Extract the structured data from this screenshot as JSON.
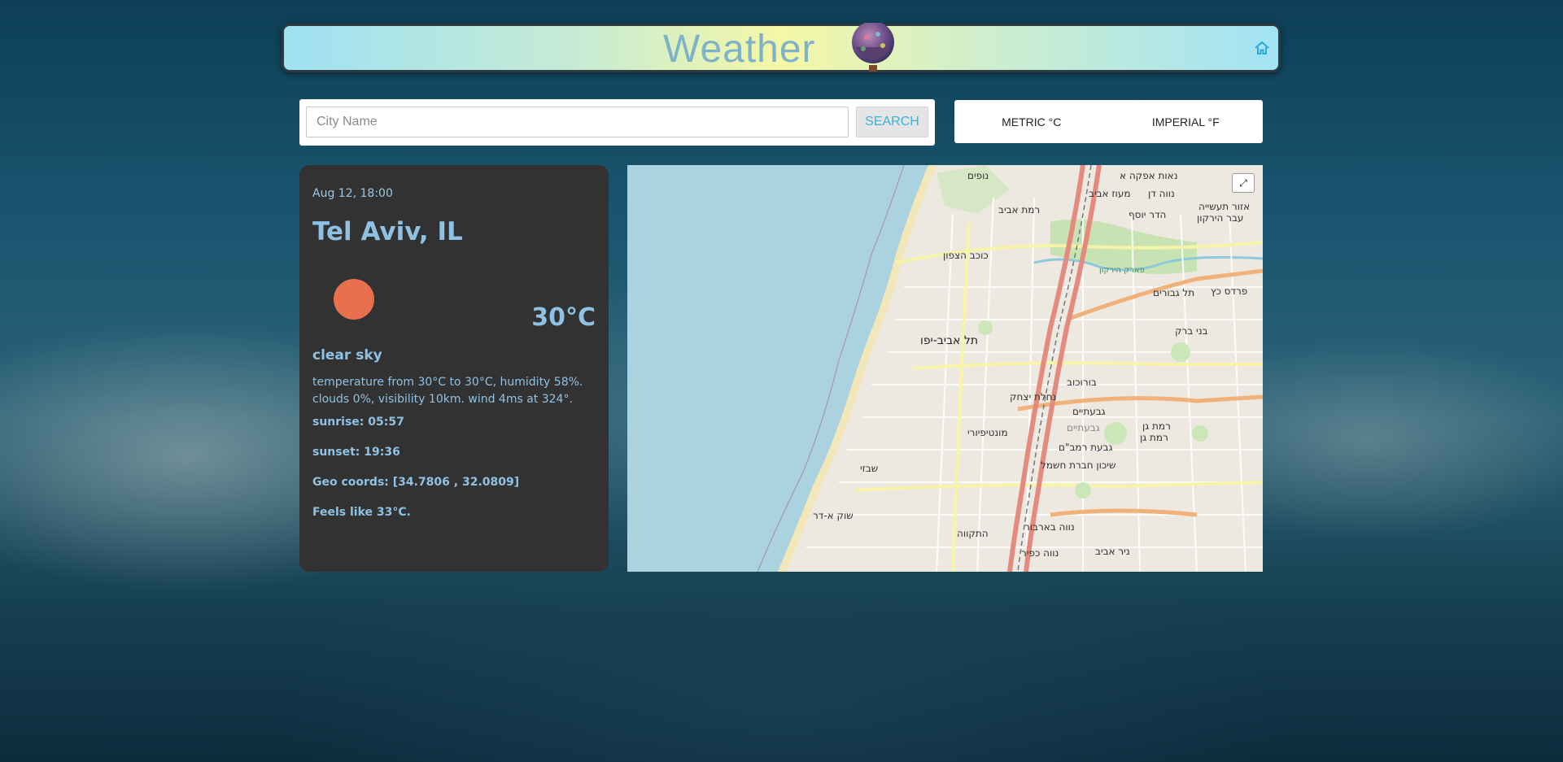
{
  "header": {
    "title": "Weather",
    "home_icon": "home-icon"
  },
  "search": {
    "placeholder": "City Name",
    "value": "",
    "button_label": "SEARCH"
  },
  "units": {
    "metric_label": "METRIC °C",
    "imperial_label": "IMPERIAL °F"
  },
  "weather": {
    "date": "Aug 12, 18:00",
    "city": "Tel Aviv, IL",
    "icon": "sun-icon",
    "temperature": "30°C",
    "description": "clear sky",
    "details": "temperature from 30°C to 30°C, humidity 58%. clouds 0%, visibility 10km. wind 4ms at 324°.",
    "sunrise": "sunrise: 05:57",
    "sunset": "sunset: 19:36",
    "geo": "Geo coords: [34.7806 , 32.0809]",
    "feels_like": "Feels like 33°C."
  },
  "map": {
    "labels": {
      "tel_aviv_yafo": "תל אביב-יפו",
      "ramat_gan": "רמת גן",
      "givatayim": "גבעתיים",
      "bnei_brak": "בני ברק",
      "shabazi": "שבזי",
      "borochov": "בורוכוב",
      "nahalat_yitzhak": "נחלת יצחק",
      "montefiore": "מונטיפיורי",
      "shuk_hadar": "שוק א-דר",
      "hatikva": "התקווה",
      "neve_barbur": "נווה בארבור",
      "neve_kfir": "נווה כפיר",
      "kochav_hatzafon": "כוכב הצפון",
      "ramat_aviv": "רמת אביב",
      "nofim": "נופים",
      "pardes_katz": "פרדס כץ",
      "tel_giborim": "תל גבורים",
      "neot_afeka": "נאות אפקה א",
      "maoz_aviv": "מעוז אביב",
      "neve_dan": "נווה דן",
      "hadar_yosef": "הדר יוסף",
      "azor_taasiya": "אזור תעשייה",
      "ever_hayarkon": "עבר הירקון",
      "shikun_chashmal": "שיכון חברת חשמל",
      "givat_rambam": "גבעת רמב\"ם",
      "nir_aviv": "ניר אביב",
      "park_hayarkon": "פארק הירקון",
      "ramat_gan_2": "רמת גן",
      "givatayim_2": "גבעתיים"
    }
  },
  "colors": {
    "card_bg": "#333232",
    "card_text": "#8fc1e3",
    "sun": "#e9704f",
    "search_button_text": "#3ab3d9",
    "sea": "#aad3df"
  }
}
